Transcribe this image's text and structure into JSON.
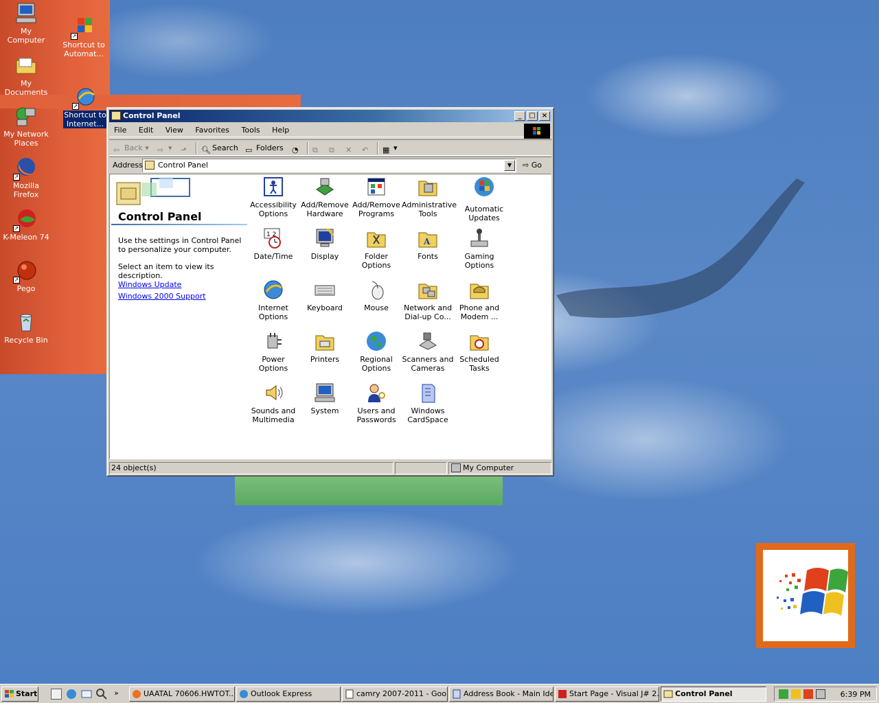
{
  "desktop": {
    "icons": [
      {
        "label": "My Computer",
        "icon": "my-computer-icon"
      },
      {
        "label": "Shortcut to Automat...",
        "icon": "windows-flag-icon"
      },
      {
        "label": "My Documents",
        "icon": "folder-icon"
      },
      {
        "label": "Shortcut to Internet...",
        "icon": "internet-explorer-icon"
      },
      {
        "label": "My Network Places",
        "icon": "network-icon"
      },
      {
        "label": "Mozilla Firefox",
        "icon": "firefox-icon"
      },
      {
        "label": "K-Meleon 74",
        "icon": "k-meleon-icon"
      },
      {
        "label": "Pego",
        "icon": "pego-icon"
      },
      {
        "label": "Recycle Bin",
        "icon": "recycle-bin-icon"
      }
    ]
  },
  "window": {
    "title": "Control Panel",
    "menu": [
      "File",
      "Edit",
      "View",
      "Favorites",
      "Tools",
      "Help"
    ],
    "toolbar": {
      "back": "Back",
      "search": "Search",
      "folders": "Folders"
    },
    "address": {
      "label": "Address",
      "value": "Control Panel",
      "go": "Go"
    },
    "left_pane": {
      "title": "Control Panel",
      "description": "Use the settings in Control Panel to personalize your computer.",
      "select_hint": "Select an item to view its description.",
      "links": [
        "Windows Update",
        "Windows 2000 Support"
      ]
    },
    "items": [
      {
        "label": "Accessibility Options",
        "icon": "accessibility-icon"
      },
      {
        "label": "Add/Remove Hardware",
        "icon": "hardware-icon"
      },
      {
        "label": "Add/Remove Programs",
        "icon": "programs-icon"
      },
      {
        "label": "Administrative Tools",
        "icon": "admin-tools-icon"
      },
      {
        "label": "Automatic Updates",
        "icon": "windows-flag-icon"
      },
      {
        "label": "Date/Time",
        "icon": "clock-icon"
      },
      {
        "label": "Display",
        "icon": "display-icon"
      },
      {
        "label": "Folder Options",
        "icon": "folder-options-icon"
      },
      {
        "label": "Fonts",
        "icon": "fonts-icon"
      },
      {
        "label": "Gaming Options",
        "icon": "joystick-icon"
      },
      {
        "label": "Internet Options",
        "icon": "internet-explorer-icon"
      },
      {
        "label": "Keyboard",
        "icon": "keyboard-icon"
      },
      {
        "label": "Mouse",
        "icon": "mouse-icon"
      },
      {
        "label": "Network and Dial-up Co...",
        "icon": "network-icon"
      },
      {
        "label": "Phone and Modem ...",
        "icon": "phone-icon"
      },
      {
        "label": "Power Options",
        "icon": "power-icon"
      },
      {
        "label": "Printers",
        "icon": "printer-icon"
      },
      {
        "label": "Regional Options",
        "icon": "globe-icon"
      },
      {
        "label": "Scanners and Cameras",
        "icon": "scanner-icon"
      },
      {
        "label": "Scheduled Tasks",
        "icon": "scheduled-tasks-icon"
      },
      {
        "label": "Sounds and Multimedia",
        "icon": "speaker-icon"
      },
      {
        "label": "System",
        "icon": "computer-icon"
      },
      {
        "label": "Users and Passwords",
        "icon": "users-icon"
      },
      {
        "label": "Windows CardSpace",
        "icon": "cardspace-icon"
      }
    ],
    "status": {
      "count": "24 object(s)",
      "zone": "My Computer"
    }
  },
  "taskbar": {
    "start": "Start",
    "tasks": [
      {
        "label": "UAATAL 70606.HWTOT...",
        "icon": "firefox-icon",
        "active": false
      },
      {
        "label": "Outlook Express",
        "icon": "outlook-icon",
        "active": false
      },
      {
        "label": "camry 2007-2011 - Goo...",
        "icon": "document-icon",
        "active": false
      },
      {
        "label": "Address Book - Main Ide...",
        "icon": "address-book-icon",
        "active": false
      },
      {
        "label": "Start Page - Visual J# 2...",
        "icon": "visual-studio-icon",
        "active": false
      },
      {
        "label": "Control Panel",
        "icon": "control-panel-icon",
        "active": true
      }
    ],
    "clock": "6:39 PM"
  }
}
